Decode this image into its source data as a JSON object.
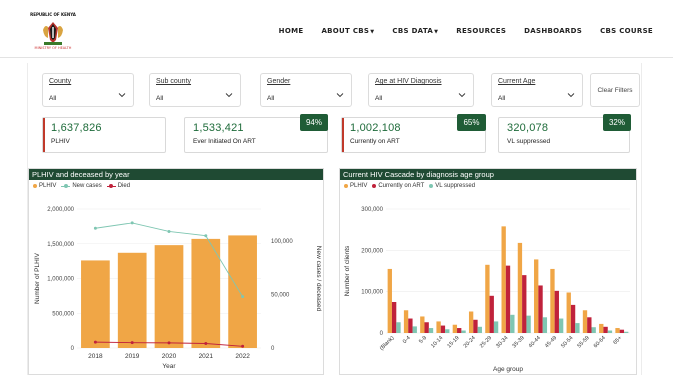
{
  "header": {
    "logo_top_text": "REPUBLIC OF KENYA",
    "logo_bottom_text": "MINISTRY OF HEALTH",
    "nav": [
      {
        "label": "HOME",
        "caret": false
      },
      {
        "label": "ABOUT CBS",
        "caret": true
      },
      {
        "label": "CBS DATA",
        "caret": true
      },
      {
        "label": "RESOURCES",
        "caret": false
      },
      {
        "label": "DASHBOARDS",
        "caret": false
      },
      {
        "label": "CBS COURSE",
        "caret": false
      }
    ]
  },
  "filters": [
    {
      "label": "County",
      "value": "All"
    },
    {
      "label": "Sub county",
      "value": "All"
    },
    {
      "label": "Gender",
      "value": "All"
    },
    {
      "label": "Age at HIV Diagnosis",
      "value": "All"
    },
    {
      "label": "Current Age",
      "value": "All"
    }
  ],
  "clear_filters_label": "Clear Filters",
  "kpis": [
    {
      "value": "1,637,826",
      "label": "PLHIV",
      "badge": ""
    },
    {
      "value": "1,533,421",
      "label": "Ever Initiated On ART",
      "badge": "94%"
    },
    {
      "value": "1,002,108",
      "label": "Currently on ART",
      "badge": "65%"
    },
    {
      "value": "320,078",
      "label": "VL suppressed",
      "badge": "32%"
    }
  ],
  "colors": {
    "orange": "#f0a646",
    "red": "#c0223b",
    "teal": "#7fc6b2",
    "green_line": "#7fc6b2",
    "dark_green": "#1f4a33",
    "kpi_green": "#1e6b3a"
  },
  "charts": {
    "left": {
      "title": "PLHIV and deceased by year",
      "legend": [
        "PLHIV",
        "New cases",
        "Died"
      ],
      "ylabel": "Number of PLHIV",
      "y2label": "New cases / deceased",
      "xlabel": "Year"
    },
    "right": {
      "title": "Current HIV Cascade by diagnosis age group",
      "legend": [
        "PLHIV",
        "Currently on ART",
        "VL suppressed"
      ],
      "ylabel": "Number of clients",
      "xlabel": "Age group"
    }
  },
  "chart_data": [
    {
      "type": "bar",
      "title": "PLHIV and deceased by year",
      "xlabel": "Year",
      "ylabel": "Number of PLHIV",
      "y2label": "New cases / deceased",
      "categories": [
        "2018",
        "2019",
        "2020",
        "2021",
        "2022"
      ],
      "ylim": [
        0,
        2000000
      ],
      "yticks": [
        0,
        500000,
        1000000,
        1500000,
        2000000
      ],
      "ytick_labels": [
        "0",
        "500,000",
        "1,000,000",
        "1,500,000",
        "2,000,000"
      ],
      "y2lim": [
        0,
        130000
      ],
      "y2ticks": [
        0,
        50000,
        100000
      ],
      "y2tick_labels": [
        "0",
        "50,000",
        "100,000"
      ],
      "series": [
        {
          "name": "PLHIV",
          "kind": "bar",
          "axis": "left",
          "values": [
            1260000,
            1370000,
            1480000,
            1570000,
            1620000
          ]
        },
        {
          "name": "New cases",
          "kind": "line",
          "axis": "right",
          "values": [
            112000,
            117000,
            109000,
            105000,
            48000
          ]
        },
        {
          "name": "Died",
          "kind": "line",
          "axis": "right",
          "values": [
            5500,
            5000,
            4800,
            4200,
            1600
          ]
        }
      ]
    },
    {
      "type": "bar",
      "title": "Current HIV Cascade by diagnosis age group",
      "xlabel": "Age group",
      "ylabel": "Number of clients",
      "categories": [
        "(Blank)",
        "0-4",
        "5-9",
        "10-14",
        "15-19",
        "20-24",
        "25-29",
        "30-34",
        "35-39",
        "40-44",
        "45-49",
        "50-54",
        "55-59",
        "60-64",
        "65+"
      ],
      "ylim": [
        0,
        300000
      ],
      "yticks": [
        0,
        100000,
        200000,
        300000
      ],
      "ytick_labels": [
        "0",
        "100,000",
        "200,000",
        "300,000"
      ],
      "series": [
        {
          "name": "PLHIV",
          "values": [
            155000,
            55000,
            40000,
            28000,
            20000,
            52000,
            165000,
            258000,
            218000,
            178000,
            155000,
            98000,
            55000,
            22000,
            12000
          ]
        },
        {
          "name": "Currently on ART",
          "values": [
            75000,
            35000,
            26000,
            18000,
            12000,
            32000,
            90000,
            163000,
            140000,
            115000,
            102000,
            68000,
            38000,
            15000,
            8000
          ]
        },
        {
          "name": "VL suppressed",
          "values": [
            26000,
            16000,
            12000,
            9000,
            6000,
            15000,
            28000,
            44000,
            42000,
            38000,
            35000,
            24000,
            14000,
            6000,
            3000
          ]
        }
      ]
    }
  ]
}
